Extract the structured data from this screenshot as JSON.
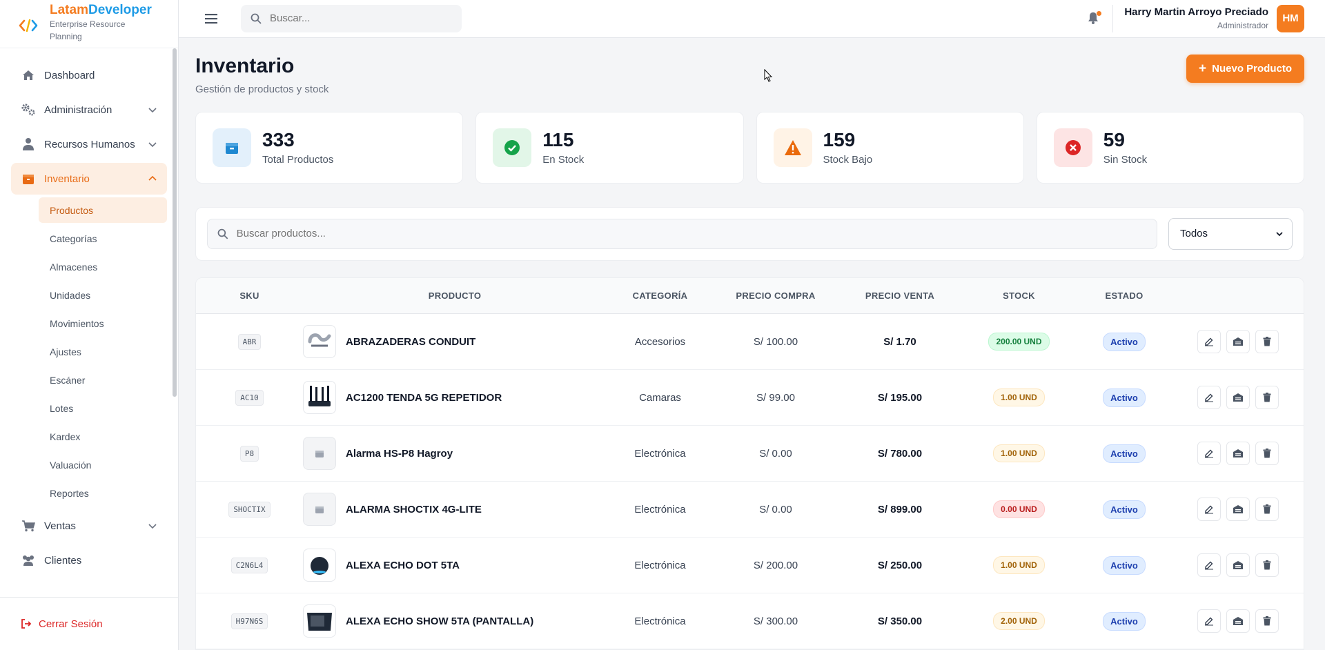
{
  "brand": {
    "name_a": "Latam",
    "name_b": "Developer",
    "subtitle": "Enterprise Resource Planning"
  },
  "nav": {
    "items": [
      {
        "label": "Dashboard",
        "icon": "home-icon"
      },
      {
        "label": "Administración",
        "icon": "gears-icon"
      },
      {
        "label": "Recursos Humanos",
        "icon": "user-tie-icon"
      },
      {
        "label": "Inventario",
        "icon": "box-icon"
      }
    ],
    "sub_items": [
      "Productos",
      "Categorías",
      "Almacenes",
      "Unidades",
      "Movimientos",
      "Ajustes",
      "Escáner",
      "Lotes",
      "Kardex",
      "Valuación",
      "Reportes"
    ],
    "after_items": [
      {
        "label": "Ventas",
        "icon": "cart-icon"
      },
      {
        "label": "Clientes",
        "icon": "users-icon"
      }
    ],
    "logout": "Cerrar Sesión"
  },
  "topbar": {
    "search_placeholder": "Buscar...",
    "user_name": "Harry Martin Arroyo Preciado",
    "user_role": "Administrador",
    "avatar_initials": "HM"
  },
  "page": {
    "title": "Inventario",
    "subtitle": "Gestión de productos y stock",
    "new_button": "Nuevo Producto"
  },
  "stats": [
    {
      "value": "333",
      "label": "Total Productos",
      "icon": "box-icon",
      "bg": "#e3f0fb",
      "color": "#1e88d1"
    },
    {
      "value": "115",
      "label": "En Stock",
      "icon": "check-circle-icon",
      "bg": "#e2f6e8",
      "color": "#16a34a"
    },
    {
      "value": "159",
      "label": "Stock Bajo",
      "icon": "warning-icon",
      "bg": "#fff3e6",
      "color": "#ea6a0c"
    },
    {
      "value": "59",
      "label": "Sin Stock",
      "icon": "x-circle-icon",
      "bg": "#fde4e4",
      "color": "#dc2626"
    }
  ],
  "filter": {
    "search_placeholder": "Buscar productos...",
    "select_value": "Todos"
  },
  "table": {
    "headers": [
      "SKU",
      "PRODUCTO",
      "CATEGORÍA",
      "PRECIO COMPRA",
      "PRECIO VENTA",
      "STOCK",
      "ESTADO",
      ""
    ],
    "rows": [
      {
        "sku": "ABR",
        "name": "ABRAZADERAS CONDUIT",
        "category": "Accesorios",
        "buy": "S/ 100.00",
        "sell": "S/ 1.70",
        "stock": "200.00 UND",
        "stock_level": "ok",
        "status": "Activo",
        "thumb": "clamp"
      },
      {
        "sku": "AC10",
        "name": "AC1200 TENDA 5G REPETIDOR",
        "category": "Camaras",
        "buy": "S/ 99.00",
        "sell": "S/ 195.00",
        "stock": "1.00 UND",
        "stock_level": "low",
        "status": "Activo",
        "thumb": "router"
      },
      {
        "sku": "P8",
        "name": "Alarma HS-P8 Hagroy",
        "category": "Electrónica",
        "buy": "S/ 0.00",
        "sell": "S/ 780.00",
        "stock": "1.00 UND",
        "stock_level": "low",
        "status": "Activo",
        "thumb": "none"
      },
      {
        "sku": "SHOCTIX",
        "name": "ALARMA SHOCTIX 4G-LITE",
        "category": "Electrónica",
        "buy": "S/ 0.00",
        "sell": "S/ 899.00",
        "stock": "0.00 UND",
        "stock_level": "out",
        "status": "Activo",
        "thumb": "none"
      },
      {
        "sku": "C2N6L4",
        "name": "ALEXA ECHO DOT 5TA",
        "category": "Electrónica",
        "buy": "S/ 200.00",
        "sell": "S/ 250.00",
        "stock": "1.00 UND",
        "stock_level": "low",
        "status": "Activo",
        "thumb": "dot"
      },
      {
        "sku": "H97N6S",
        "name": "ALEXA ECHO SHOW 5TA (PANTALLA)",
        "category": "Electrónica",
        "buy": "S/ 300.00",
        "sell": "S/ 350.00",
        "stock": "2.00 UND",
        "stock_level": "low",
        "status": "Activo",
        "thumb": "show"
      }
    ]
  }
}
